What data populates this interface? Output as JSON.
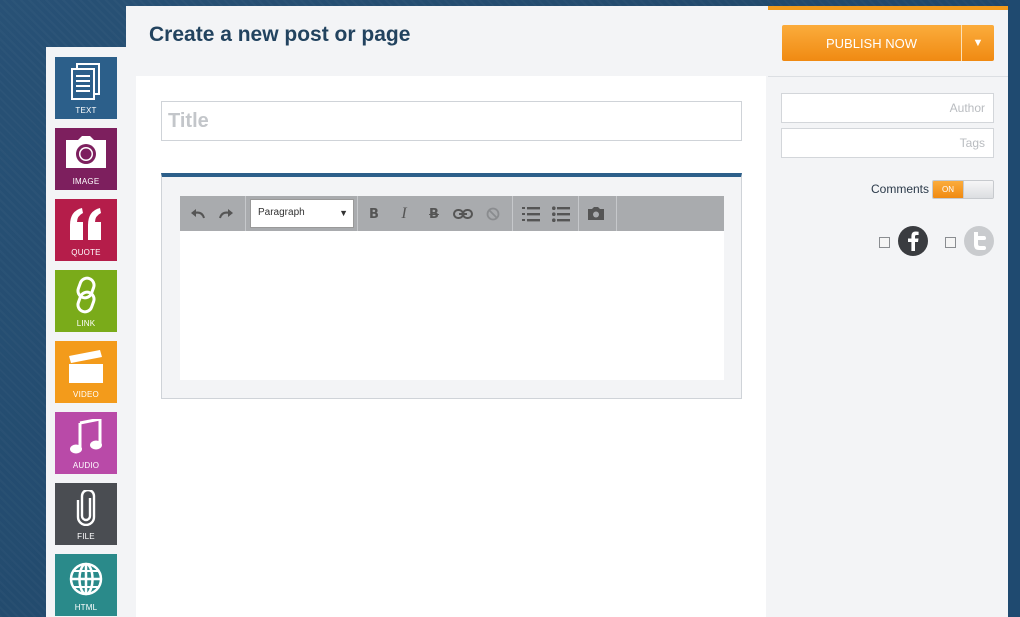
{
  "page": {
    "title": "Create a new post or page"
  },
  "tools": [
    {
      "label": "TEXT",
      "icon": "text-document-icon",
      "color": "#2c5f8a"
    },
    {
      "label": "IMAGE",
      "icon": "camera-icon",
      "color": "#7d1f5e"
    },
    {
      "label": "QUOTE",
      "icon": "quote-icon",
      "color": "#b51d4a"
    },
    {
      "label": "LINK",
      "icon": "link-icon",
      "color": "#7aab1a"
    },
    {
      "label": "VIDEO",
      "icon": "clapperboard-icon",
      "color": "#f39b1b"
    },
    {
      "label": "AUDIO",
      "icon": "music-note-icon",
      "color": "#b94aa8"
    },
    {
      "label": "FILE",
      "icon": "paperclip-icon",
      "color": "#4a4d52"
    },
    {
      "label": "HTML",
      "icon": "globe-icon",
      "color": "#2a8a8a"
    }
  ],
  "editor": {
    "title_placeholder": "Title",
    "format_select": "Paragraph",
    "toolbar_icons": [
      "undo-icon",
      "redo-icon",
      "bold-icon",
      "italic-icon",
      "strikethrough-icon",
      "link-icon",
      "unlink-icon",
      "ordered-list-icon",
      "unordered-list-icon",
      "camera-icon"
    ]
  },
  "sidebar": {
    "publish_label": "PUBLISH NOW",
    "author_placeholder": "Author",
    "tags_placeholder": "Tags",
    "comments_label": "Comments",
    "comments_toggle": "ON",
    "social": [
      "facebook-icon",
      "twitter-icon"
    ]
  },
  "colors": {
    "accent": "#f39b1b",
    "heading": "#22435f",
    "background": "#1f4a70"
  }
}
